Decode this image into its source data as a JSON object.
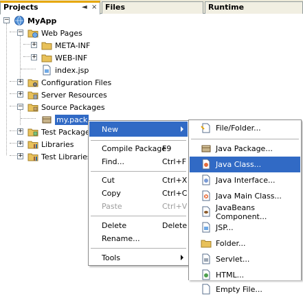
{
  "tabs": [
    {
      "label": "Projects",
      "active": true
    },
    {
      "label": "Files",
      "active": false
    },
    {
      "label": "Runtime",
      "active": false
    }
  ],
  "tab_controls": {
    "minimize": "◄",
    "close": "×"
  },
  "tree": {
    "root": "MyApp",
    "web_pages": "Web Pages",
    "meta_inf": "META-INF",
    "web_inf": "WEB-INF",
    "index_jsp": "index.jsp",
    "config_files": "Configuration Files",
    "server_resources": "Server Resources",
    "source_packages": "Source Packages",
    "my_pack": "my.pack",
    "test_packages": "Test Package",
    "libraries": "Libraries",
    "test_libraries": "Test Libraries"
  },
  "context_menu": {
    "new": "New",
    "compile_package": "Compile Package",
    "compile_key": "F9",
    "find": "Find...",
    "find_key": "Ctrl+F",
    "cut": "Cut",
    "cut_key": "Ctrl+X",
    "copy": "Copy",
    "copy_key": "Ctrl+C",
    "paste": "Paste",
    "paste_key": "Ctrl+V",
    "delete": "Delete",
    "delete_key": "Delete",
    "rename": "Rename...",
    "tools": "Tools"
  },
  "submenu": {
    "file_folder": "File/Folder...",
    "java_package": "Java Package...",
    "java_class": "Java Class...",
    "java_interface": "Java Interface...",
    "java_main_class": "Java Main Class...",
    "javabeans": "JavaBeans Component...",
    "jsp": "JSP...",
    "folder": "Folder...",
    "servlet": "Servlet...",
    "html": "HTML...",
    "empty_file": "Empty File..."
  },
  "colors": {
    "selection": "#316ac5",
    "tab_accent": "#e6a70d",
    "folder": "#e8c15a"
  }
}
